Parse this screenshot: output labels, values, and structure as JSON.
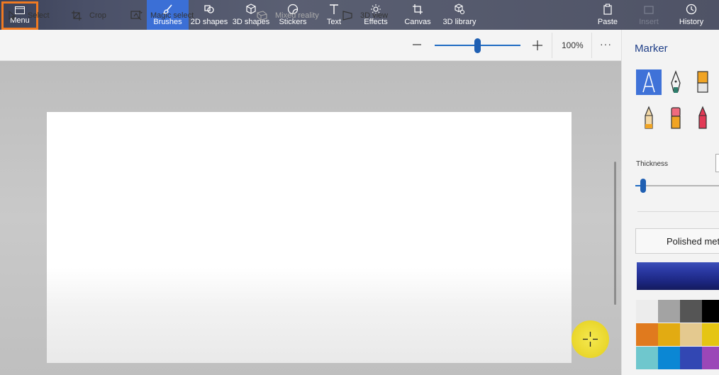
{
  "menu": {
    "label": "Menu",
    "icon": "folder-icon"
  },
  "ribbon": {
    "brushes": "Brushes",
    "shapes2d": "2D shapes",
    "shapes3d": "3D shapes",
    "stickers": "Stickers",
    "text": "Text",
    "effects": "Effects",
    "canvas": "Canvas",
    "library3d": "3D library",
    "paste": "Paste",
    "insert": "Insert",
    "history": "History"
  },
  "toolbar": {
    "select": "Select",
    "crop": "Crop",
    "magic_select": "Magic select",
    "mixed_reality": "Mixed reality",
    "view3d": "3D view",
    "zoom_percent": "100%",
    "zoom_level": 0.5,
    "more": "···"
  },
  "panel": {
    "title": "Marker",
    "thickness_label": "Thickness",
    "thickness_level": 0.06,
    "finish_label": "Polished met",
    "selected_color": "#2b39a3",
    "brushes": [
      "marker",
      "calligraphy-pen",
      "oil-brush",
      "pencil",
      "eraser",
      "crayon"
    ]
  },
  "palette": [
    "#ececec",
    "#a3a3a3",
    "#555555",
    "#000000",
    "#e07a1e",
    "#e2ab12",
    "#e4c98f",
    "#e5c513",
    "#6fc7cd",
    "#0b87d4",
    "#3247b3",
    "#9b47b8"
  ],
  "colors": {
    "accent": "#3b6fd6",
    "menu_highlight": "#f07a22"
  }
}
